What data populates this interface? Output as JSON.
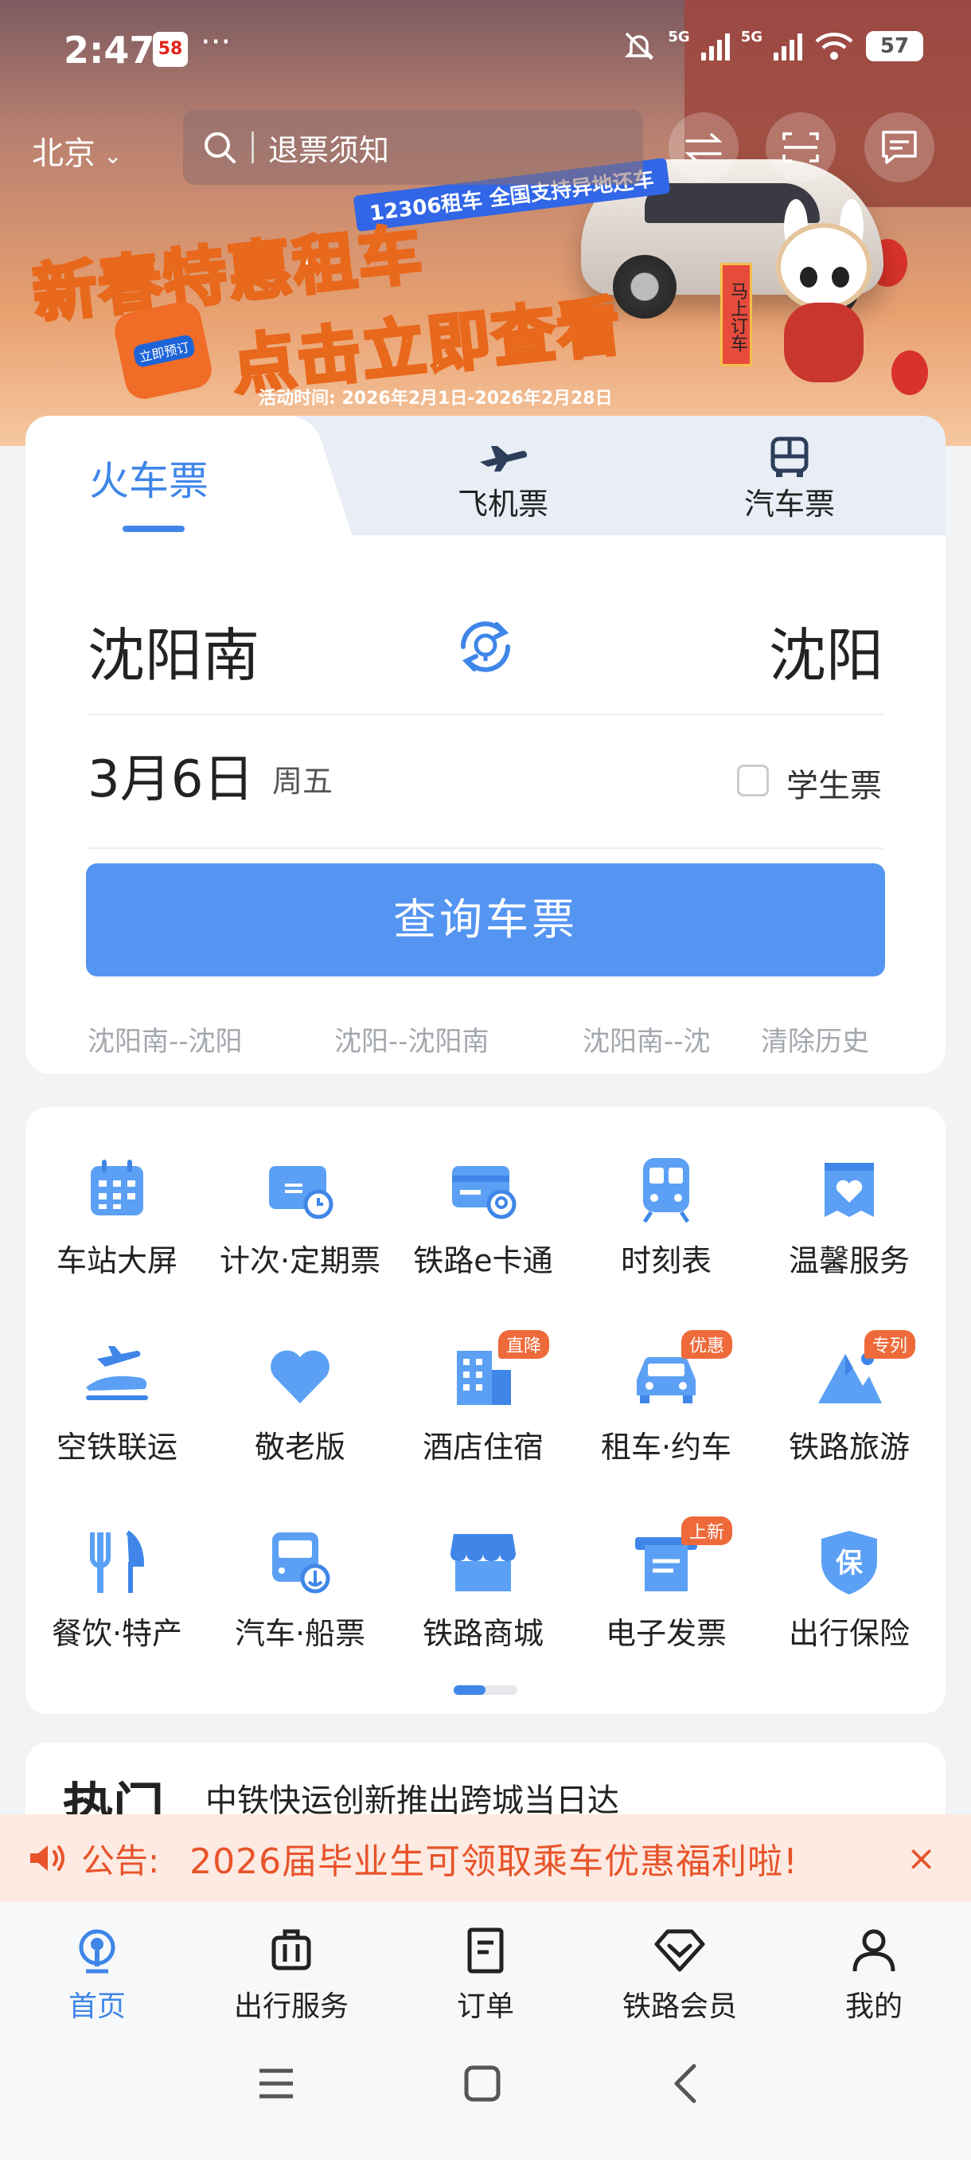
{
  "status_bar": {
    "time": "2:47",
    "app_badge": "58",
    "more": "···",
    "signal_1": "5G",
    "signal_2": "5G",
    "battery": "57"
  },
  "header": {
    "city": "北京",
    "search_placeholder": "退票须知"
  },
  "banner": {
    "tag": "12306租车 全国支持异地还车",
    "line1": "新春特惠租车",
    "line2": "点击立即查看",
    "hand_label": "立即预订",
    "date_range": "活动时间: 2026年2月1日-2026年2月28日",
    "sign_text": "马上订车"
  },
  "tabs": [
    {
      "label": "火车票",
      "active": true
    },
    {
      "label": "飞机票",
      "active": false
    },
    {
      "label": "汽车票",
      "active": false
    }
  ],
  "ticket": {
    "from": "沈阳南",
    "to": "沈阳",
    "date": "3月6日",
    "weekday": "周五",
    "student_label": "学生票",
    "student_checked": false,
    "search_button": "查询车票"
  },
  "history": {
    "items": [
      "沈阳南--沈阳",
      "沈阳--沈阳南",
      "沈阳南--沈"
    ],
    "clear": "清除历史"
  },
  "services": [
    {
      "label": "车站大屏",
      "icon": "calendar-icon"
    },
    {
      "label": "计次·定期票",
      "icon": "card-clock-icon"
    },
    {
      "label": "铁路e卡通",
      "icon": "railway-card-icon"
    },
    {
      "label": "时刻表",
      "icon": "train-icon"
    },
    {
      "label": "温馨服务",
      "icon": "heart-bag-icon"
    },
    {
      "label": "空铁联运",
      "icon": "plane-train-icon"
    },
    {
      "label": "敬老版",
      "icon": "heart-icon"
    },
    {
      "label": "酒店住宿",
      "icon": "hotel-icon",
      "badge": "直降"
    },
    {
      "label": "租车·约车",
      "icon": "car-icon",
      "badge": "优惠"
    },
    {
      "label": "铁路旅游",
      "icon": "mountain-icon",
      "badge": "专列"
    },
    {
      "label": "餐饮·特产",
      "icon": "dining-icon"
    },
    {
      "label": "汽车·船票",
      "icon": "bus-icon"
    },
    {
      "label": "铁路商城",
      "icon": "shop-icon"
    },
    {
      "label": "电子发票",
      "icon": "invoice-icon",
      "badge": "上新"
    },
    {
      "label": "出行保险",
      "icon": "insurance-icon"
    }
  ],
  "services_pager": {
    "active_page": 1,
    "total_pages": 2
  },
  "news": {
    "hot_label": "热门",
    "headline": "中铁快运创新推出跨城当日达"
  },
  "notice": {
    "label": "公告:",
    "message": "2026届毕业生可领取乘车优惠福利啦!",
    "close": "×"
  },
  "bottom_nav": [
    {
      "label": "首页",
      "active": true
    },
    {
      "label": "出行服务",
      "active": false
    },
    {
      "label": "订单",
      "active": false
    },
    {
      "label": "铁路会员",
      "active": false
    },
    {
      "label": "我的",
      "active": false
    }
  ],
  "colors": {
    "accent": "#3f86e8",
    "button": "#5595f2",
    "notice": "#e8532a",
    "badge": "#ee6a3a"
  }
}
